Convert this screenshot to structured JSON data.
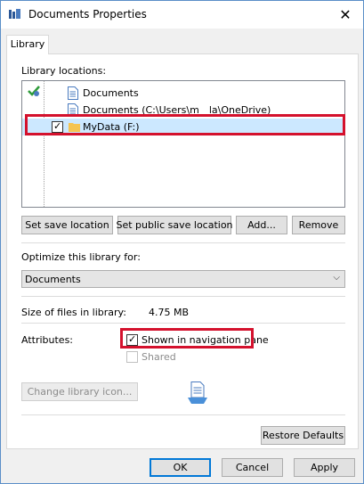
{
  "window": {
    "title": "Documents Properties",
    "close_glyph": "✕"
  },
  "tab": {
    "label": "Library"
  },
  "locations": {
    "label": "Library locations:",
    "items": [
      {
        "name": "Documents"
      },
      {
        "name": "Documents (C:\\Users\\m__la\\OneDrive)"
      },
      {
        "name": "MyData (F:)",
        "checked_glyph": "✓"
      }
    ]
  },
  "location_buttons": {
    "set_save": "Set save location",
    "set_public": "Set public save location",
    "add": "Add...",
    "remove": "Remove"
  },
  "optimize": {
    "label": "Optimize this library for:",
    "value": "Documents",
    "arrow": "⌵"
  },
  "size": {
    "label": "Size of files in library:",
    "value": "4.75 MB"
  },
  "attributes": {
    "label": "Attributes:",
    "shown_nav": {
      "label": "Shown in navigation pane",
      "glyph": "✓"
    },
    "shared": {
      "label": "Shared"
    }
  },
  "change_icon": {
    "label": "Change library icon..."
  },
  "restore": {
    "label": "Restore Defaults"
  },
  "footer": {
    "ok": "OK",
    "cancel": "Cancel",
    "apply": "Apply"
  },
  "colors": {
    "highlight": "#d4112d",
    "selection": "#cce8ff",
    "accent": "#0078d7"
  }
}
